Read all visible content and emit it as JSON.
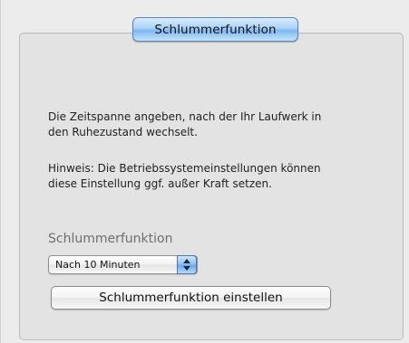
{
  "panel": {
    "tab_label": "Schlummerfunktion",
    "description": "Die Zeitspanne angeben, nach der Ihr Laufwerk in den Ruhezustand wechselt.",
    "note": "Hinweis: Die Betriebssystemeinstellungen können diese Einstellung ggf. außer Kraft setzen.",
    "section_label": "Schlummerfunktion",
    "sleep_select": {
      "selected": "Nach 10 Minuten"
    },
    "apply_button_label": "Schlummerfunktion einstellen"
  },
  "colors": {
    "accent_blue": "#7db8f0",
    "panel_bg": "#e3e3e3",
    "label_gray": "#6e6e6e"
  },
  "icons": {
    "popup_arrows": "updown-arrows-icon"
  }
}
